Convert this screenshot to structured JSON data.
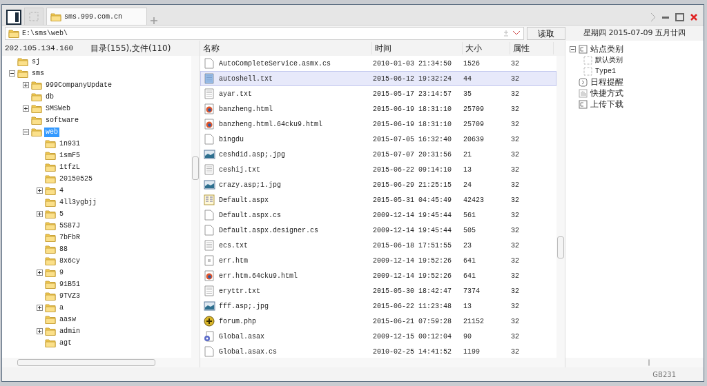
{
  "tabs": [
    {
      "label": "sms.999.com.cn",
      "selected": true
    }
  ],
  "address": {
    "value": "E:\\sms\\web\\"
  },
  "read_button": "读取",
  "date": "星期四 2015-07-09 五月廿四",
  "host": "202.105.134.160",
  "counts": "目录(155),文件(110)",
  "columns": [
    "名称",
    "时间",
    "大小",
    "属性"
  ],
  "tree": [
    {
      "label": "sj",
      "selected": false
    },
    {
      "label": "sms",
      "selected": false,
      "expanded": true,
      "children": [
        {
          "label": "999CompanyUpdate",
          "selected": false,
          "expanded": false
        },
        {
          "label": "db",
          "selected": false
        },
        {
          "label": "SMSWeb",
          "selected": false,
          "expanded": false
        },
        {
          "label": "software",
          "selected": false
        },
        {
          "label": "web",
          "selected": true,
          "expanded": true,
          "children": [
            {
              "label": "1n931",
              "selected": false
            },
            {
              "label": "1smF5",
              "selected": false
            },
            {
              "label": "1tfzL",
              "selected": false
            },
            {
              "label": "20150525",
              "selected": false
            },
            {
              "label": "4",
              "selected": false,
              "expanded": false
            },
            {
              "label": "4ll3ygbjj",
              "selected": false
            },
            {
              "label": "5",
              "selected": false,
              "expanded": false
            },
            {
              "label": "5S87J",
              "selected": false
            },
            {
              "label": "7bFbR",
              "selected": false
            },
            {
              "label": "88",
              "selected": false
            },
            {
              "label": "8x6cy",
              "selected": false
            },
            {
              "label": "9",
              "selected": false,
              "expanded": false
            },
            {
              "label": "91B51",
              "selected": false
            },
            {
              "label": "9TVZ3",
              "selected": false
            },
            {
              "label": "a",
              "selected": false,
              "expanded": false
            },
            {
              "label": "aasw",
              "selected": false
            },
            {
              "label": "admin",
              "selected": false,
              "expanded": false
            },
            {
              "label": "agt",
              "selected": false
            }
          ]
        }
      ]
    }
  ],
  "files": [
    {
      "kind": "file",
      "name": "AutoCompleteService.asmx.cs",
      "time": "2010-01-03 21:34:50",
      "size": "1526",
      "attr": "32",
      "selected": false
    },
    {
      "kind": "text",
      "name": "autoshell.txt",
      "time": "2015-06-12 19:32:24",
      "size": "44",
      "attr": "32",
      "selected": true
    },
    {
      "kind": "text",
      "name": "ayar.txt",
      "time": "2015-05-17 23:14:57",
      "size": "35",
      "attr": "32",
      "selected": false
    },
    {
      "kind": "html",
      "name": "banzheng.html",
      "time": "2015-06-19 18:31:10",
      "size": "25709",
      "attr": "32",
      "selected": false
    },
    {
      "kind": "html",
      "name": "banzheng.html.64cku9.html",
      "time": "2015-06-19 18:31:10",
      "size": "25709",
      "attr": "32",
      "selected": false
    },
    {
      "kind": "file",
      "name": "bingdu",
      "time": "2015-07-05 16:32:40",
      "size": "20639",
      "attr": "32",
      "selected": false
    },
    {
      "kind": "image",
      "name": "ceshdid.asp;.jpg",
      "time": "2015-07-07 20:31:56",
      "size": "21",
      "attr": "32",
      "selected": false
    },
    {
      "kind": "text",
      "name": "ceshij.txt",
      "time": "2015-06-22 09:14:10",
      "size": "13",
      "attr": "32",
      "selected": false
    },
    {
      "kind": "image",
      "name": "crazy.asp;1.jpg",
      "time": "2015-06-29 21:25:15",
      "size": "24",
      "attr": "32",
      "selected": false
    },
    {
      "kind": "aspx",
      "name": "Default.aspx",
      "time": "2015-05-31 04:45:49",
      "size": "42423",
      "attr": "32",
      "selected": false
    },
    {
      "kind": "file",
      "name": "Default.aspx.cs",
      "time": "2009-12-14 19:45:44",
      "size": "561",
      "attr": "32",
      "selected": false
    },
    {
      "kind": "file",
      "name": "Default.aspx.designer.cs",
      "time": "2009-12-14 19:45:44",
      "size": "505",
      "attr": "32",
      "selected": false
    },
    {
      "kind": "text",
      "name": "ecs.txt",
      "time": "2015-06-18 17:51:55",
      "size": "23",
      "attr": "32",
      "selected": false
    },
    {
      "kind": "htm",
      "name": "err.htm",
      "time": "2009-12-14 19:52:26",
      "size": "641",
      "attr": "32",
      "selected": false
    },
    {
      "kind": "html",
      "name": "err.htm.64cku9.html",
      "time": "2009-12-14 19:52:26",
      "size": "641",
      "attr": "32",
      "selected": false
    },
    {
      "kind": "text",
      "name": "eryttr.txt",
      "time": "2015-05-30 18:42:47",
      "size": "7374",
      "attr": "32",
      "selected": false
    },
    {
      "kind": "image",
      "name": "fff.asp;.jpg",
      "time": "2015-06-22 11:23:48",
      "size": "13",
      "attr": "32",
      "selected": false
    },
    {
      "kind": "php",
      "name": "forum.php",
      "time": "2015-06-21 07:59:28",
      "size": "21152",
      "attr": "32",
      "selected": false
    },
    {
      "kind": "asax",
      "name": "Global.asax",
      "time": "2009-12-15 00:12:04",
      "size": "90",
      "attr": "32",
      "selected": false
    },
    {
      "kind": "file",
      "name": "Global.asax.cs",
      "time": "2010-02-25 14:41:52",
      "size": "1199",
      "attr": "32",
      "selected": false
    }
  ],
  "side_tree": [
    {
      "kind": "category",
      "label": "站点类别",
      "expanded": true,
      "children": [
        {
          "kind": "item",
          "label": "默认类别"
        },
        {
          "kind": "item",
          "label": "Type1"
        }
      ]
    },
    {
      "kind": "schedule",
      "label": "日程提醒"
    },
    {
      "kind": "shortcut",
      "label": "快捷方式"
    },
    {
      "kind": "transfer",
      "label": "上传下载"
    }
  ],
  "status": "GB231"
}
